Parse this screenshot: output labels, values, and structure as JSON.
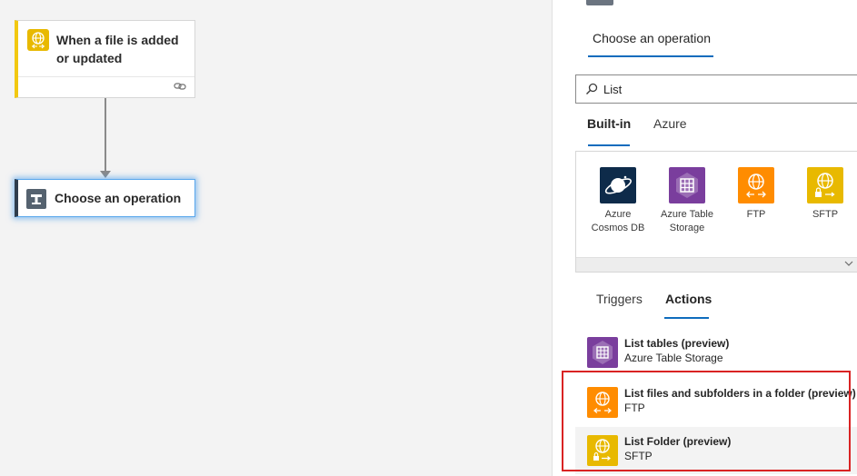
{
  "canvas": {
    "trigger": {
      "title": "When a file is added or updated",
      "icon": "ftp-globe-icon",
      "accent": "#f2c811"
    },
    "step": {
      "title": "Choose an operation",
      "icon": "operation-icon"
    }
  },
  "panel": {
    "header": "Choose an operation",
    "search": {
      "value": "List",
      "placeholder": ""
    },
    "tabs": [
      {
        "label": "Built-in",
        "active": true
      },
      {
        "label": "Azure",
        "active": false
      }
    ],
    "connectors": [
      {
        "label": "Azure Cosmos DB",
        "color": "#0e2b4a",
        "icon": "planet-icon"
      },
      {
        "label": "Azure Table Storage",
        "color": "#7a3e9d",
        "icon": "table-icon"
      },
      {
        "label": "FTP",
        "color": "#ff8c00",
        "icon": "ftp-globe-icon"
      },
      {
        "label": "SFTP",
        "color": "#e8b900",
        "icon": "sftp-globe-lock-icon"
      }
    ],
    "subtabs": [
      {
        "label": "Triggers",
        "active": false
      },
      {
        "label": "Actions",
        "active": true
      }
    ],
    "actions": [
      {
        "name": "List tables (preview)",
        "connector": "Azure Table Storage",
        "color": "#7a3e9d",
        "icon": "table-icon"
      },
      {
        "name": "List files and subfolders in a folder (preview)",
        "connector": "FTP",
        "color": "#ff8c00",
        "icon": "ftp-globe-icon"
      },
      {
        "name": "List Folder (preview)",
        "connector": "SFTP",
        "color": "#e8b900",
        "icon": "sftp-globe-lock-icon"
      }
    ],
    "highlight_color": "#d92323"
  }
}
